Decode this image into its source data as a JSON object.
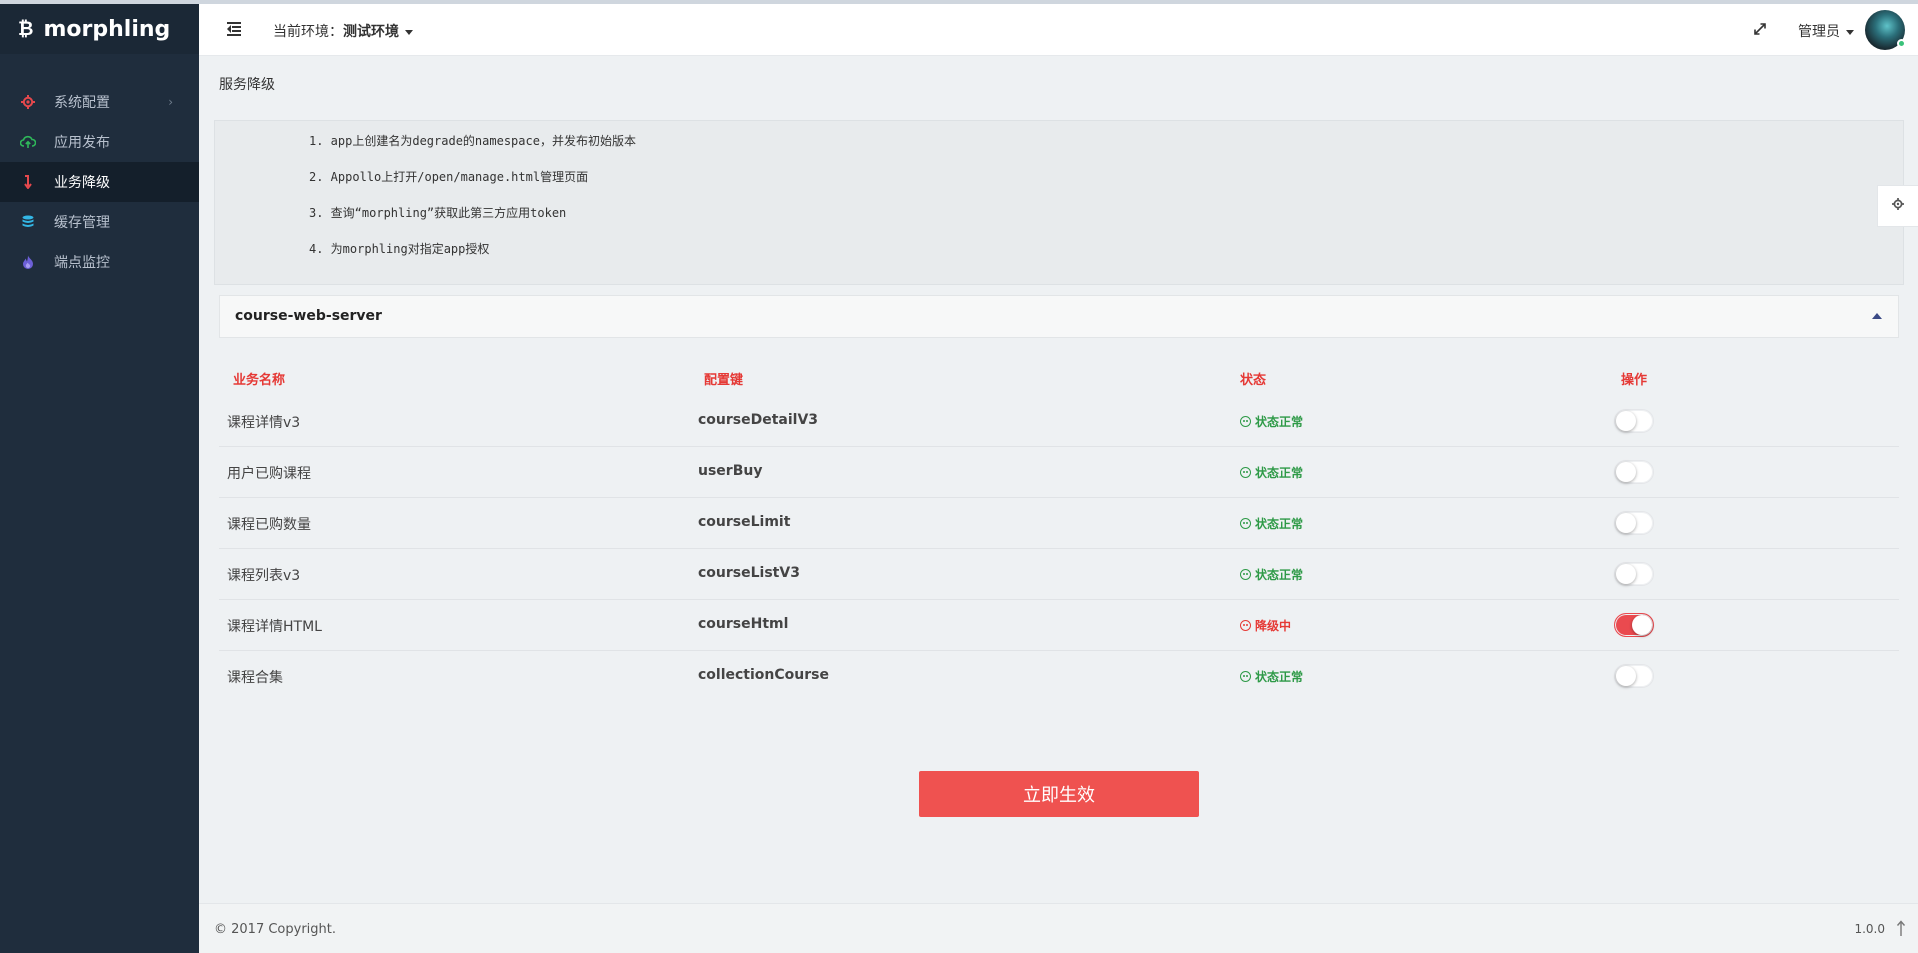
{
  "app": {
    "name": "morphling"
  },
  "sidebar": {
    "items": [
      {
        "label": "系统配置",
        "icon": "gear-icon",
        "icon_color": "#e5484d",
        "has_submenu": true
      },
      {
        "label": "应用发布",
        "icon": "cloud-upload-icon",
        "icon_color": "#2fb85a"
      },
      {
        "label": "业务降级",
        "icon": "down-arrow-icon",
        "icon_color": "#e5484d",
        "active": true
      },
      {
        "label": "缓存管理",
        "icon": "database-icon",
        "icon_color": "#33b7e6"
      },
      {
        "label": "端点监控",
        "icon": "flame-icon",
        "icon_color": "#6c5fd6"
      }
    ]
  },
  "header": {
    "env_label": "当前环境：",
    "env_value": "测试环境",
    "user_label": "管理员"
  },
  "breadcrumb": {
    "title": "服务降级"
  },
  "notes": [
    "1. app上创建名为degrade的namespace，并发布初始版本",
    "2. Appollo上打开/open/manage.html管理页面",
    "3. 查询“morphling”获取此第三方应用token",
    "4. 为morphling对指定app授权"
  ],
  "panel": {
    "title": "course-web-server"
  },
  "table": {
    "columns": [
      "业务名称",
      "配置键",
      "状态",
      "操作"
    ],
    "rows": [
      {
        "name": "课程详情v3",
        "key": "courseDetailV3",
        "status": "状态正常",
        "degraded": false
      },
      {
        "name": "用户已购课程",
        "key": "userBuy",
        "status": "状态正常",
        "degraded": false
      },
      {
        "name": "课程已购数量",
        "key": "courseLimit",
        "status": "状态正常",
        "degraded": false
      },
      {
        "name": "课程列表v3",
        "key": "courseListV3",
        "status": "状态正常",
        "degraded": false
      },
      {
        "name": "课程详情HTML",
        "key": "courseHtml",
        "status": "降级中",
        "degraded": true
      },
      {
        "name": "课程合集",
        "key": "collectionCourse",
        "status": "状态正常",
        "degraded": false
      }
    ],
    "status_colors": {
      "normal": "#2e9a47",
      "degraded": "#e53935"
    }
  },
  "actions": {
    "apply_label": "立即生效"
  },
  "footer": {
    "copyright": "© 2017 Copyright.",
    "version": "1.0.0"
  },
  "colors": {
    "accent": "#ef5250",
    "sidebar_bg": "#1f2d3d"
  }
}
